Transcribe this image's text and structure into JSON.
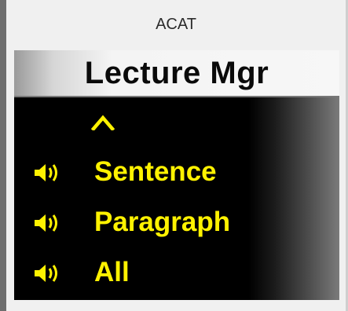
{
  "window": {
    "title": "ACAT"
  },
  "header": {
    "title": "Lecture Mgr"
  },
  "menu": {
    "up_icon": "chevron-up-icon",
    "items": [
      {
        "label": "Sentence",
        "icon": "speaker-icon"
      },
      {
        "label": "Paragraph",
        "icon": "speaker-icon"
      },
      {
        "label": "All",
        "icon": "speaker-icon"
      }
    ]
  },
  "colors": {
    "text_accent": "#fff200",
    "panel_bg": "#000000",
    "header_bg": "#f4f4f4"
  }
}
